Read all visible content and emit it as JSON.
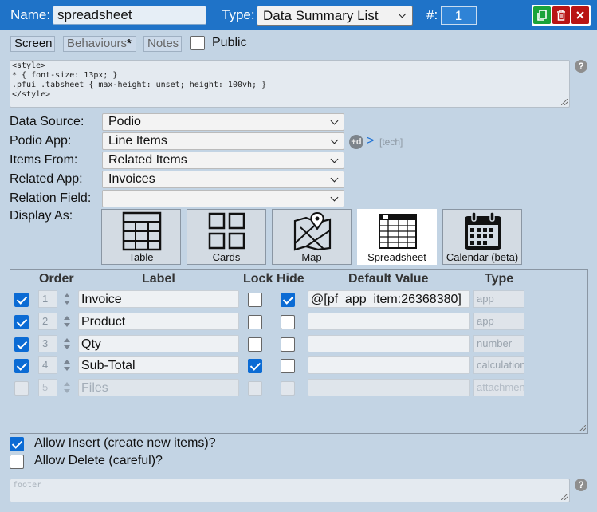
{
  "header": {
    "name_label": "Name:",
    "name_value": "spreadsheet",
    "type_label": "Type:",
    "type_value": "Data Summary List",
    "num_label": "#:",
    "num_value": "1",
    "colors": {
      "bar": "#1f73c8",
      "copy": "#1aa33a",
      "delete": "#b81414",
      "close": "#b81414"
    }
  },
  "tabs": {
    "screen": "Screen",
    "behaviours": "Behaviours",
    "behaviours_mark": "*",
    "notes": "Notes",
    "public_label": "Public",
    "public_checked": false
  },
  "style_code": "<style>\n* { font-size: 13px; }\n.pfui .tabsheet { max-height: unset; height: 100vh; }\n</style>",
  "help_glyph": "?",
  "fields": {
    "data_source": {
      "label": "Data Source:",
      "value": "Podio"
    },
    "podio_app": {
      "label": "Podio App:",
      "value": "Line Items",
      "badge": "+d",
      "arrow": ">",
      "tech": "[tech]"
    },
    "items_from": {
      "label": "Items From:",
      "value": "Related Items"
    },
    "related_app": {
      "label": "Related App:",
      "value": "Invoices"
    },
    "relation_field": {
      "label": "Relation Field:",
      "value": ""
    }
  },
  "display_as": {
    "label": "Display As:",
    "options": [
      "Table",
      "Cards",
      "Map",
      "Spreadsheet",
      "Calendar (beta)"
    ],
    "selected": "Spreadsheet"
  },
  "table": {
    "headers": {
      "order": "Order",
      "label": "Label",
      "lock": "Lock",
      "hide": "Hide",
      "default": "Default Value",
      "type": "Type"
    },
    "rows": [
      {
        "enabled": true,
        "order": "1",
        "label": "Invoice",
        "lock": false,
        "hide": true,
        "default": "@[pf_app_item:26368380]",
        "type": "app"
      },
      {
        "enabled": true,
        "order": "2",
        "label": "Product",
        "lock": false,
        "hide": false,
        "default": "",
        "type": "app"
      },
      {
        "enabled": true,
        "order": "3",
        "label": "Qty",
        "lock": false,
        "hide": false,
        "default": "",
        "type": "number"
      },
      {
        "enabled": true,
        "order": "4",
        "label": "Sub-Total",
        "lock": true,
        "hide": false,
        "default": "",
        "type": "calculation"
      },
      {
        "enabled": false,
        "order": "5",
        "label": "Files",
        "lock": false,
        "hide": false,
        "default": "",
        "type": "attachment"
      }
    ]
  },
  "options": {
    "allow_insert": {
      "label": "Allow Insert (create new items)?",
      "checked": true
    },
    "allow_delete": {
      "label": "Allow Delete (careful)?",
      "checked": false
    }
  },
  "footer_placeholder": "footer",
  "icons": [
    "copy-icon",
    "trash-icon",
    "close-icon",
    "table-icon",
    "cards-icon",
    "map-icon",
    "spreadsheet-icon",
    "calendar-icon",
    "help-icon",
    "chevron-down-icon"
  ]
}
